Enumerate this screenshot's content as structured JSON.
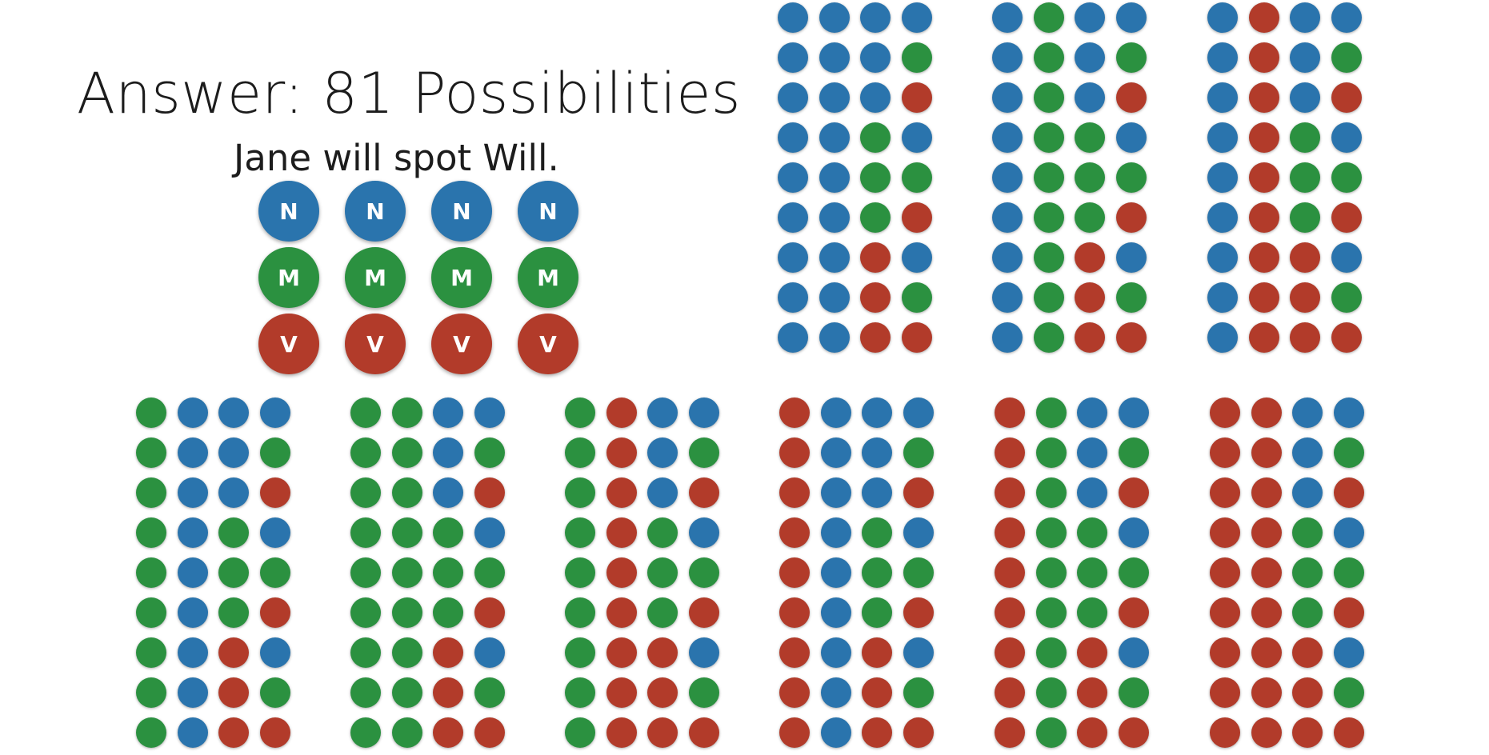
{
  "title": "Answer: 81 Possibilities",
  "subtitle": "Jane will spot Will.",
  "colors": {
    "N": "#2a74ad",
    "M": "#2b9140",
    "V": "#b23b2a"
  },
  "legend": {
    "rows": [
      {
        "letter": "N",
        "color_key": "N"
      },
      {
        "letter": "M",
        "color_key": "M"
      },
      {
        "letter": "V",
        "color_key": "V"
      }
    ],
    "columns": 4
  },
  "combination_order": [
    "N",
    "M",
    "V"
  ],
  "total_possibilities": 81,
  "groups": [
    {
      "position": "top-1",
      "first": "N",
      "second": "N"
    },
    {
      "position": "top-2",
      "first": "N",
      "second": "M"
    },
    {
      "position": "top-3",
      "first": "N",
      "second": "V"
    },
    {
      "position": "bottom-1",
      "first": "M",
      "second": "N"
    },
    {
      "position": "bottom-2",
      "first": "M",
      "second": "M"
    },
    {
      "position": "bottom-3",
      "first": "M",
      "second": "V"
    },
    {
      "position": "bottom-4",
      "first": "V",
      "second": "N"
    },
    {
      "position": "bottom-5",
      "first": "V",
      "second": "M"
    },
    {
      "position": "bottom-6",
      "first": "V",
      "second": "V"
    }
  ]
}
